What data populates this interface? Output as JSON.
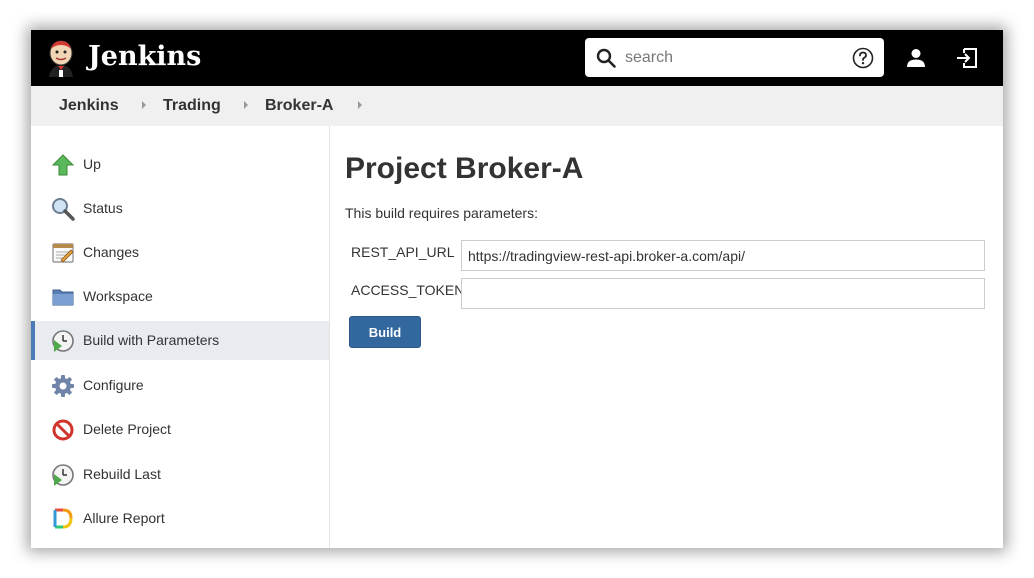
{
  "header": {
    "brand": "Jenkins",
    "search": {
      "placeholder": "search"
    }
  },
  "breadcrumb": [
    "Jenkins",
    "Trading",
    "Broker-A"
  ],
  "sidebar": {
    "items": [
      {
        "label": "Up",
        "icon": "up-arrow-icon"
      },
      {
        "label": "Status",
        "icon": "magnifier-icon"
      },
      {
        "label": "Changes",
        "icon": "notepad-icon"
      },
      {
        "label": "Workspace",
        "icon": "folder-icon"
      },
      {
        "label": "Build with Parameters",
        "icon": "clock-play-icon",
        "active": true
      },
      {
        "label": "Configure",
        "icon": "gear-icon"
      },
      {
        "label": "Delete Project",
        "icon": "no-entry-icon"
      },
      {
        "label": "Rebuild Last",
        "icon": "clock-play-icon"
      },
      {
        "label": "Allure Report",
        "icon": "allure-icon"
      }
    ]
  },
  "main": {
    "title": "Project Broker-A",
    "description": "This build requires parameters:",
    "params": [
      {
        "label": "REST_API_URL",
        "value": "https://tradingview-rest-api.broker-a.com/api/"
      },
      {
        "label": "ACCESS_TOKEN",
        "value": ""
      }
    ],
    "build_label": "Build"
  },
  "colors": {
    "header_bg": "#000000",
    "breadcrumb_bg": "#f0f0f0",
    "active_item_bg": "#e8ecf1",
    "active_item_border": "#4a7bb7",
    "build_button": "#33689e"
  }
}
